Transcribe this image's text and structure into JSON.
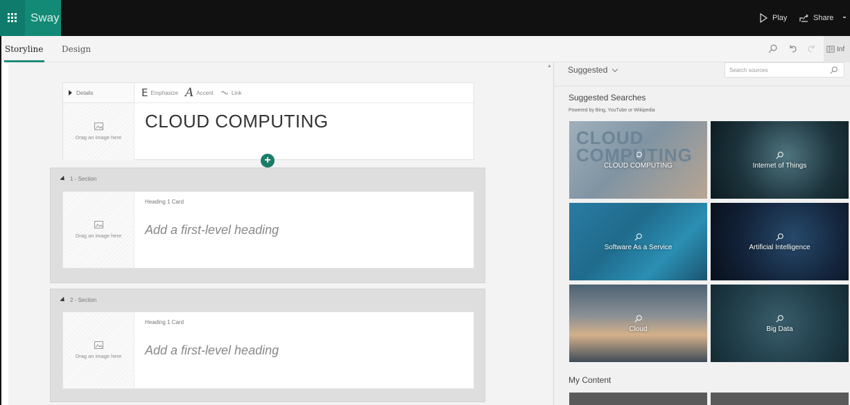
{
  "app": {
    "name": "Sway"
  },
  "topbar": {
    "play_label": "Play",
    "share_label": "Share"
  },
  "tabs": [
    {
      "label": "Storyline",
      "active": true
    },
    {
      "label": "Design",
      "active": false
    }
  ],
  "toolbar": {
    "info_label": "Inf"
  },
  "title_card": {
    "details_label": "Details",
    "format": {
      "emphasize_label": "Emphasize",
      "accent_label": "Accent",
      "link_label": "Link"
    },
    "image_placeholder": "Drag an image here",
    "title": "CLOUD COMPUTING"
  },
  "sections": [
    {
      "label": "1 - Section",
      "card_label": "Heading 1 Card",
      "image_placeholder": "Drag an image here",
      "heading_placeholder": "Add a first-level heading"
    },
    {
      "label": "2 - Section",
      "card_label": "Heading 1 Card",
      "image_placeholder": "Drag an image here",
      "heading_placeholder": "Add a first-level heading"
    }
  ],
  "right_panel": {
    "dropdown_label": "Suggested",
    "search_placeholder": "Search sources",
    "suggested_title": "Suggested Searches",
    "powered_by": "Powered by Bing, YouTube or Wikipedia",
    "tiles": [
      {
        "label": "CLOUD COMPUTING",
        "bg_text": "CLOUD COMPUTING"
      },
      {
        "label": "Internet of Things"
      },
      {
        "label": "Software As a Service"
      },
      {
        "label": "Artificial Intelligence"
      },
      {
        "label": "Cloud"
      },
      {
        "label": "Big Data"
      }
    ],
    "my_content_title": "My Content"
  },
  "colors": {
    "accent": "#1b8b77",
    "topbar": "#111111",
    "app_tile": "#138a76",
    "add_button": "#1b7d69"
  }
}
